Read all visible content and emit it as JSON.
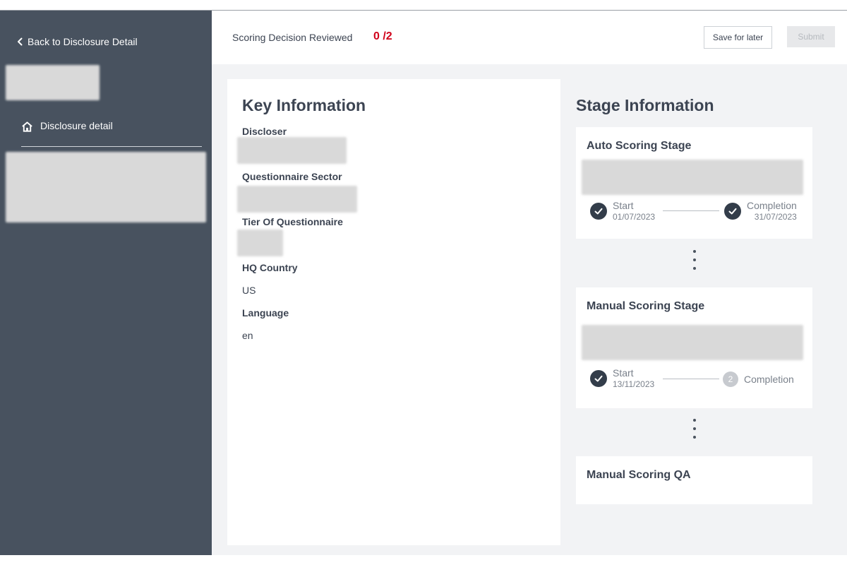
{
  "sidebar": {
    "back_label": "Back to Disclosure Detail",
    "nav_item_label": "Disclosure detail"
  },
  "topbar": {
    "score_label": "Scoring Decision Reviewed",
    "score_count": "0 /2",
    "save_label": "Save for later",
    "submit_label": "Submit"
  },
  "key_info": {
    "title": "Key Information",
    "fields": [
      {
        "label": "Discloser",
        "value": ""
      },
      {
        "label": "Questionnaire Sector",
        "value": ""
      },
      {
        "label": "Tier Of Questionnaire",
        "value": ""
      },
      {
        "label": "HQ Country",
        "value": "US"
      },
      {
        "label": "Language",
        "value": "en"
      }
    ]
  },
  "stage_info": {
    "title": "Stage Information",
    "stages": [
      {
        "name": "Auto Scoring Stage",
        "start_label": "Start",
        "start_date": "01/07/2023",
        "end_label": "Completion",
        "end_date": "31/07/2023",
        "end_status": "done"
      },
      {
        "name": "Manual Scoring Stage",
        "start_label": "Start",
        "start_date": "13/11/2023",
        "end_label": "Completion",
        "end_step_number": "2",
        "end_status": "pending"
      },
      {
        "name": "Manual Scoring QA"
      }
    ]
  },
  "colors": {
    "sidebar_bg": "#48525f",
    "accent_red": "#d0021b",
    "text": "#3c4452",
    "step_done": "#333d4a",
    "step_pending": "#c7cacf"
  },
  "icons": {
    "back": "chevron-left-icon",
    "nav": "home-icon",
    "step_done": "check-circle-icon"
  }
}
